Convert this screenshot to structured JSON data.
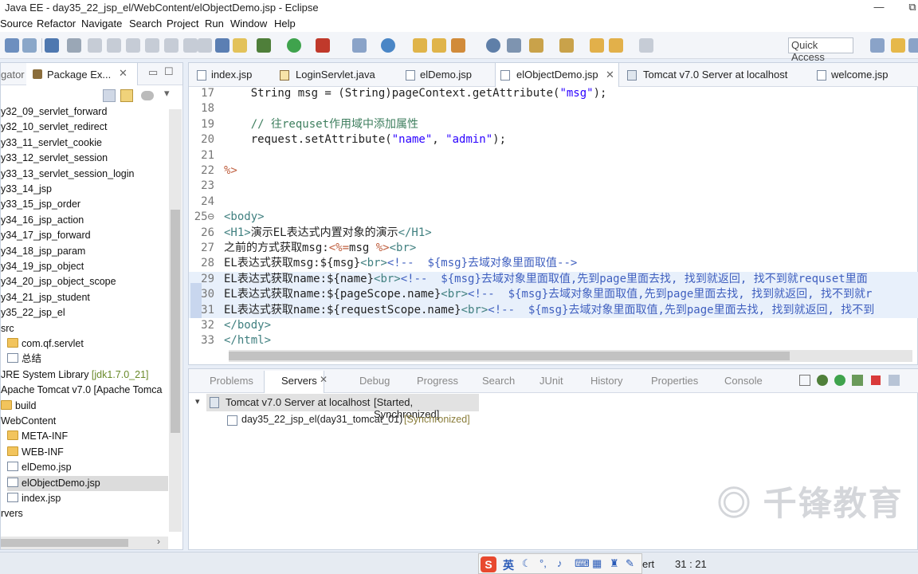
{
  "window": {
    "title": "Java EE - day35_22_jsp_el/WebContent/elObjectDemo.jsp - Eclipse",
    "minimize": "—",
    "maximize": "⧉"
  },
  "menu": [
    "Source",
    "Refactor",
    "Navigate",
    "Search",
    "Project",
    "Run",
    "Window",
    "Help"
  ],
  "quick_access": "Quick Access",
  "left_panel": {
    "tabs": [
      "gator",
      "Package Ex..."
    ],
    "items": [
      "y32_09_servlet_forward",
      "y32_10_servlet_redirect",
      "y33_11_servlet_cookie",
      "y33_12_servlet_session",
      "y33_13_servlet_session_login",
      "y33_14_jsp",
      "y33_15_jsp_order",
      "y34_16_jsp_action",
      "y34_17_jsp_forward",
      "y34_18_jsp_param",
      "y34_19_jsp_object",
      "y34_20_jsp_object_scope",
      "y34_21_jsp_student",
      "y35_22_jsp_el",
      "src",
      "com.qf.servlet",
      "总结",
      "JRE System Library",
      "Apache Tomcat v7.0 [Apache Tomca",
      "build",
      "WebContent",
      "META-INF",
      "WEB-INF",
      "elDemo.jsp",
      "elObjectDemo.jsp",
      "index.jsp",
      "rvers"
    ],
    "jre_version": "[jdk1.7.0_21]"
  },
  "editor": {
    "tabs": [
      "index.jsp",
      "LoginServlet.java",
      "elDemo.jsp",
      "elObjectDemo.jsp",
      "Tomcat v7.0 Server at localhost",
      "welcome.jsp"
    ],
    "active_tab": "elObjectDemo.jsp",
    "lines": [
      {
        "n": "17",
        "text": "    String msg = (String)pageContext.getAttribute(\"msg\");"
      },
      {
        "n": "18",
        "text": ""
      },
      {
        "n": "19",
        "text": "    // 往requset作用域中添加属性"
      },
      {
        "n": "20",
        "text": "    request.setAttribute(\"name\", \"admin\");"
      },
      {
        "n": "21",
        "text": ""
      },
      {
        "n": "22",
        "text": "%>"
      },
      {
        "n": "23",
        "text": ""
      },
      {
        "n": "24",
        "text": ""
      },
      {
        "n": "25⊖",
        "text": "<body>"
      },
      {
        "n": "26",
        "text": "<H1>演示EL表达式内置对象的演示</H1>"
      },
      {
        "n": "27",
        "text": "之前的方式获取msg:<%=msg %><br>"
      },
      {
        "n": "28",
        "text": "EL表达式获取msg:${msg}<br><!--  ${msg}去域对象里面取值-->"
      },
      {
        "n": "29",
        "text": "EL表达式获取name:${name}<br><!--  ${msg}去域对象里面取值,先到page里面去找, 找到就返回, 找不到就requset里面"
      },
      {
        "n": "30",
        "text": "EL表达式获取name:${pageScope.name}<br><!--  ${msg}去域对象里面取值,先到page里面去找, 找到就返回, 找不到就r"
      },
      {
        "n": "31",
        "text": "EL表达式获取name:${requestScope.name}<br><!--  ${msg}去域对象里面取值,先到page里面去找, 找到就返回, 找不到"
      },
      {
        "n": "32",
        "text": "</body>"
      },
      {
        "n": "33",
        "text": "</html>"
      }
    ],
    "scroll_position": 0.82
  },
  "bottom": {
    "tabs": [
      "Problems",
      "Servers",
      "Debug",
      "Progress",
      "Search",
      "JUnit",
      "History",
      "Properties",
      "Console"
    ],
    "active_tab": "Servers",
    "server": {
      "name": "Tomcat v7.0 Server at localhost",
      "state": "[Started, Synchronized]"
    },
    "module": {
      "name": "day35_22_jsp_el(day31_tomcat_01)",
      "state": "[Synchronized]"
    }
  },
  "status": {
    "insert_mode": "ert",
    "position": "31 : 21"
  },
  "watermark": "千锋教育",
  "ime": "英"
}
